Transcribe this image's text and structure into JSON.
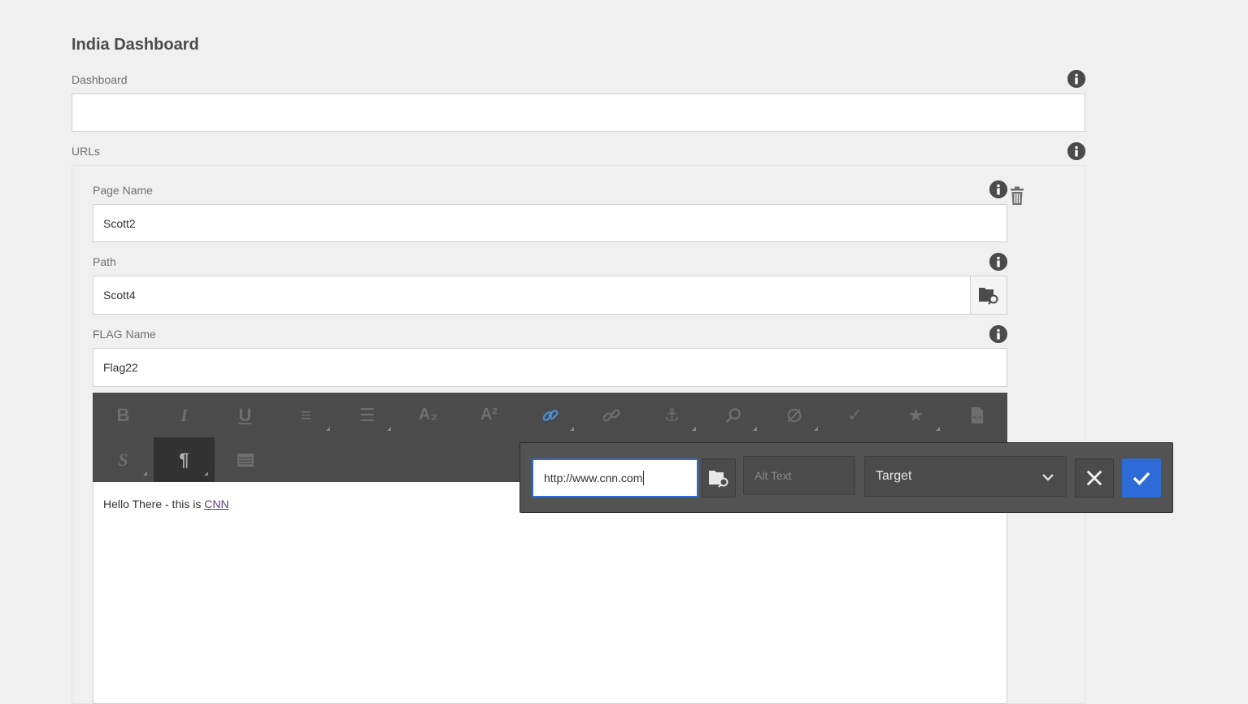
{
  "page": {
    "title": "India Dashboard"
  },
  "dashboard": {
    "label": "Dashboard",
    "value": ""
  },
  "urls": {
    "label": "URLs"
  },
  "item": {
    "page_name_label": "Page Name",
    "page_name_value": "Scott2",
    "path_label": "Path",
    "path_value": "Scott4",
    "flag_label": "FLAG Name",
    "flag_value": "Flag22"
  },
  "toolbar": {
    "buttons": [
      {
        "name": "bold",
        "glyph": "B"
      },
      {
        "name": "italic",
        "glyph": "I"
      },
      {
        "name": "underline",
        "glyph": "U"
      },
      {
        "name": "justify",
        "glyph": "≡"
      },
      {
        "name": "list",
        "glyph": "☰"
      },
      {
        "name": "subscript",
        "glyph": "A₂"
      },
      {
        "name": "superscript",
        "glyph": "A²"
      },
      {
        "name": "link",
        "glyph": "🔗"
      },
      {
        "name": "unlink",
        "glyph": "⛓"
      },
      {
        "name": "anchor",
        "glyph": "⚓"
      },
      {
        "name": "find",
        "glyph": "⌕"
      },
      {
        "name": "spellcheck",
        "glyph": "✎"
      },
      {
        "name": "check",
        "glyph": "✓"
      },
      {
        "name": "special-chars",
        "glyph": "★"
      },
      {
        "name": "source",
        "glyph": "▤"
      },
      {
        "name": "strikethrough",
        "glyph": "S"
      },
      {
        "name": "paragraph",
        "glyph": "¶"
      },
      {
        "name": "table",
        "glyph": "▦"
      }
    ]
  },
  "editor": {
    "text_before": "Hello There - this is ",
    "link_text": "CNN"
  },
  "link_dialog": {
    "url_value": "http://www.cnn.com",
    "alt_placeholder": "Alt Text",
    "target_value": "Target"
  },
  "colors": {
    "accent": "#2d6bd6",
    "toolbar": "#4b4b4b",
    "link": "#5c3e8a"
  }
}
